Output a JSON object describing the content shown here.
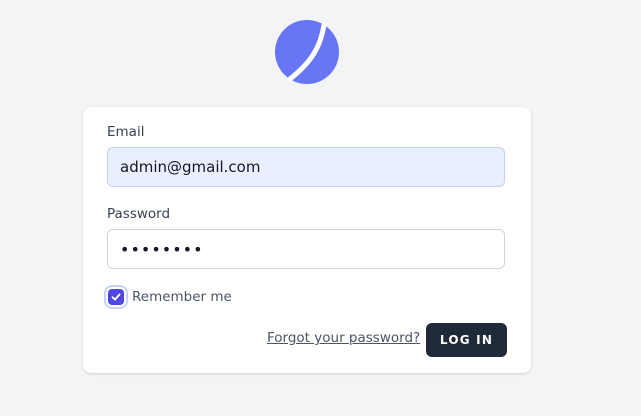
{
  "app": {
    "logo_icon": "crescent-logo-icon",
    "accent_color": "#6875f5"
  },
  "form": {
    "email_label": "Email",
    "email_value": "admin@gmail.com",
    "password_label": "Password",
    "password_value": "••••••••",
    "remember_label": "Remember me",
    "remember_checked": true,
    "forgot_link": "Forgot your password?",
    "login_button": "LOG IN"
  }
}
